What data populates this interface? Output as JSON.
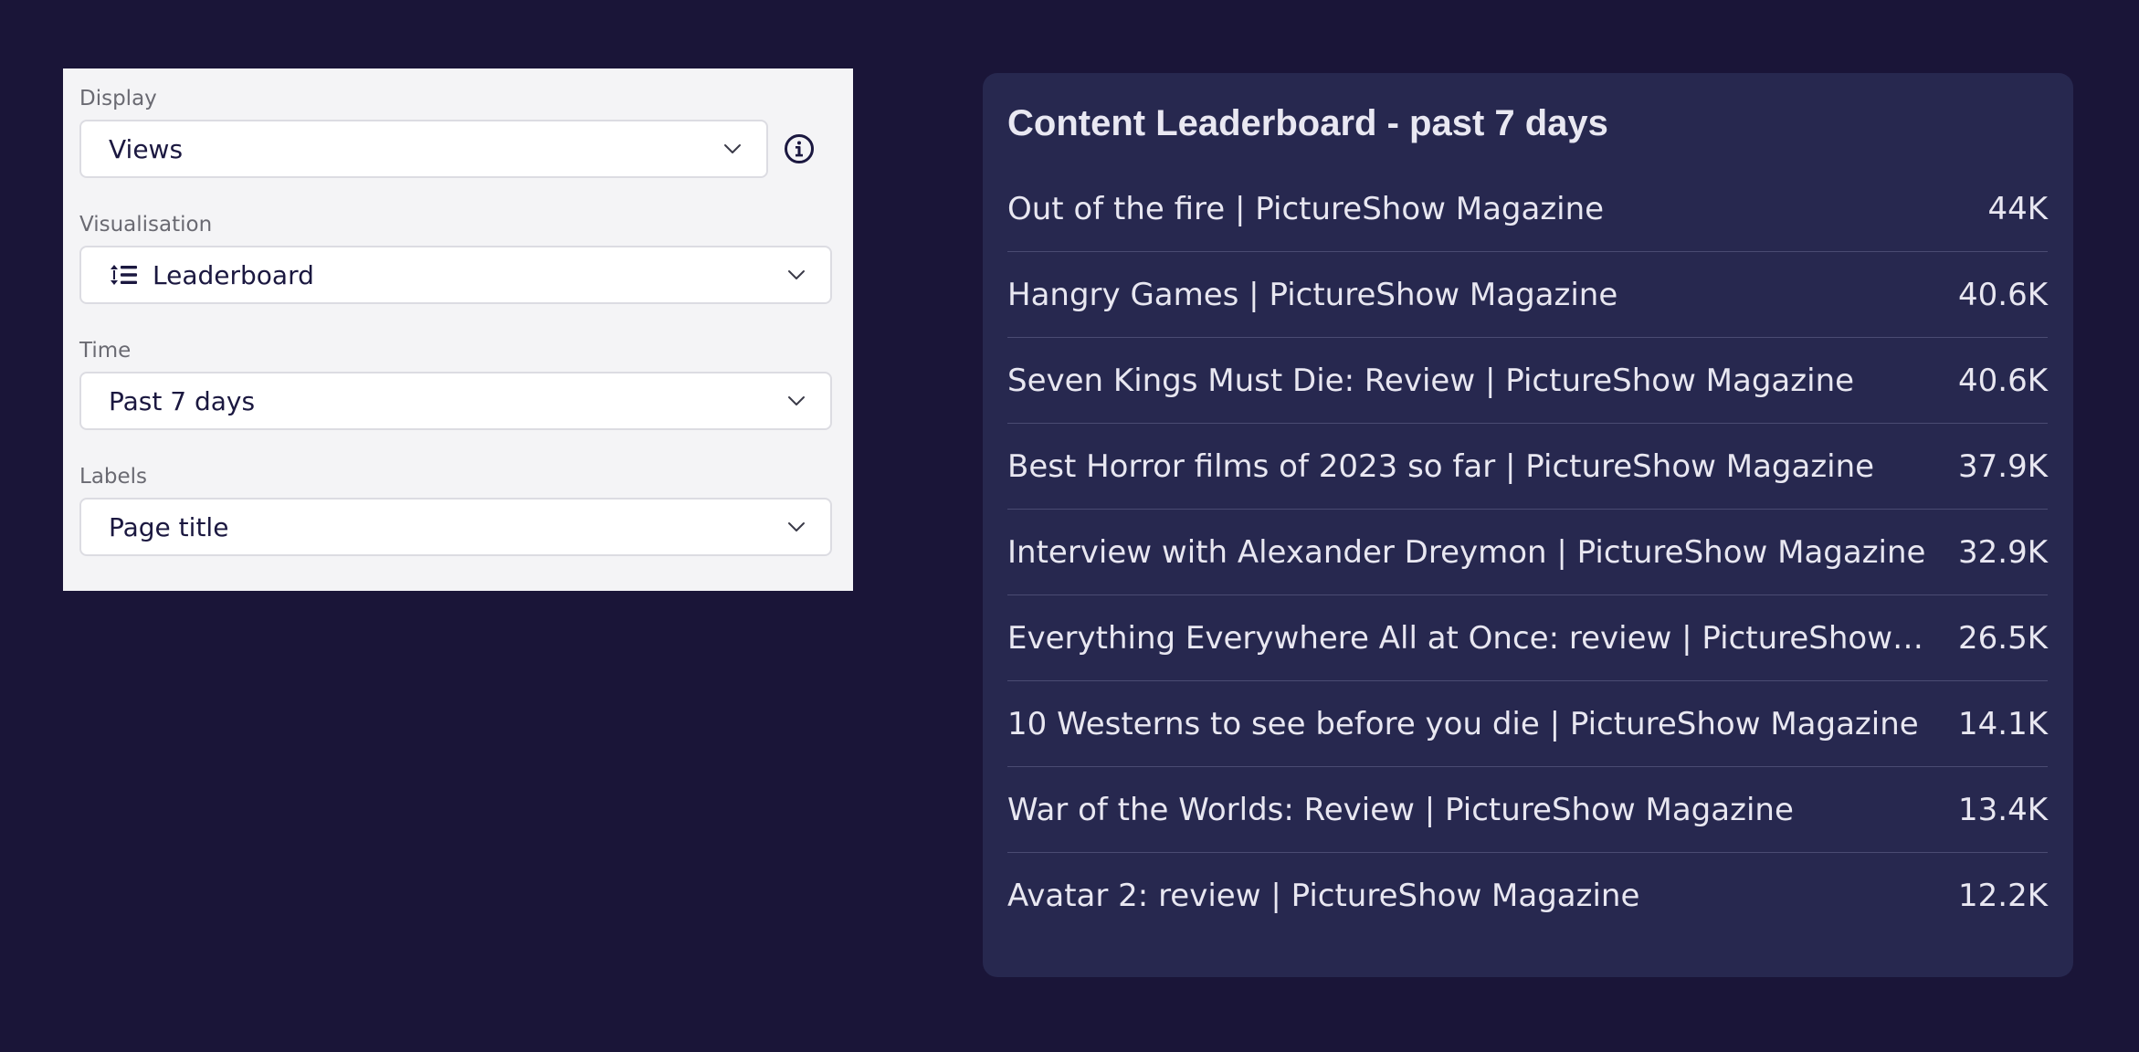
{
  "settings": {
    "display": {
      "label": "Display",
      "value": "Views",
      "info_icon": "info-circle-icon"
    },
    "visualisation": {
      "label": "Visualisation",
      "value": "Leaderboard",
      "icon": "list-sort-icon"
    },
    "time": {
      "label": "Time",
      "value": "Past 7 days"
    },
    "labels": {
      "label": "Labels",
      "value": "Page title"
    }
  },
  "leaderboard": {
    "title": "Content Leaderboard - past 7 days",
    "rows": [
      {
        "title": "Out of the fire  | PictureShow Magazine",
        "value": "44K"
      },
      {
        "title": "Hangry Games | PictureShow Magazine",
        "value": "40.6K"
      },
      {
        "title": "Seven Kings Must Die: Review | PictureShow Magazine",
        "value": "40.6K"
      },
      {
        "title": "Best Horror films of 2023 so far  | PictureShow Magazine",
        "value": "37.9K"
      },
      {
        "title": "Interview with Alexander Dreymon  | PictureShow Magazine",
        "value": "32.9K"
      },
      {
        "title": "Everything Everywhere All at Once: review | PictureShow Magazine",
        "value": "26.5K"
      },
      {
        "title": "10 Westerns to see before you die | PictureShow Magazine",
        "value": "14.1K"
      },
      {
        "title": "War of the Worlds: Review | PictureShow Magazine",
        "value": "13.4K"
      },
      {
        "title": "Avatar 2: review | PictureShow Magazine",
        "value": "12.2K"
      }
    ]
  },
  "colors": {
    "background": "#1a1538",
    "panel": "#f4f4f6",
    "card": "#27284f",
    "text_light": "#e8e7f1",
    "text_dark": "#1b1840"
  }
}
